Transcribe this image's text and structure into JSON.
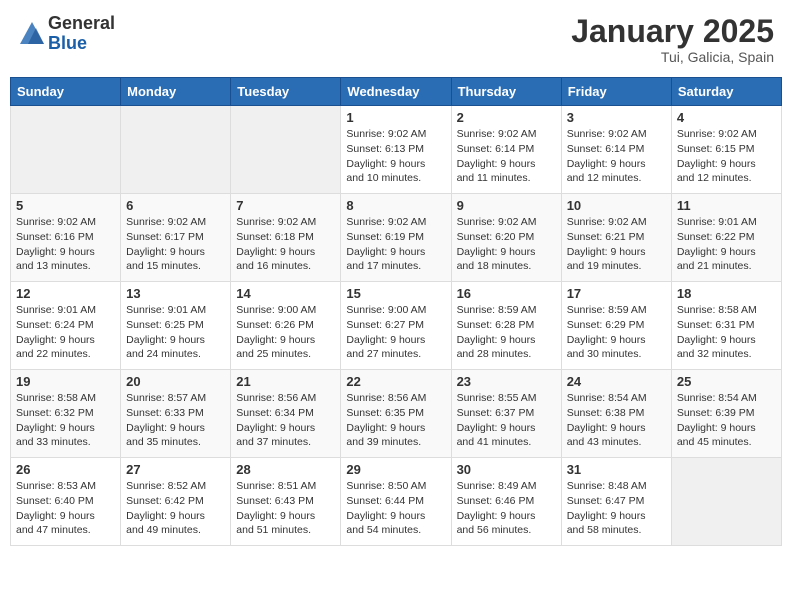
{
  "header": {
    "logo_general": "General",
    "logo_blue": "Blue",
    "month_title": "January 2025",
    "location": "Tui, Galicia, Spain"
  },
  "weekdays": [
    "Sunday",
    "Monday",
    "Tuesday",
    "Wednesday",
    "Thursday",
    "Friday",
    "Saturday"
  ],
  "weeks": [
    [
      {
        "day": "",
        "info": ""
      },
      {
        "day": "",
        "info": ""
      },
      {
        "day": "",
        "info": ""
      },
      {
        "day": "1",
        "info": "Sunrise: 9:02 AM\nSunset: 6:13 PM\nDaylight: 9 hours\nand 10 minutes."
      },
      {
        "day": "2",
        "info": "Sunrise: 9:02 AM\nSunset: 6:14 PM\nDaylight: 9 hours\nand 11 minutes."
      },
      {
        "day": "3",
        "info": "Sunrise: 9:02 AM\nSunset: 6:14 PM\nDaylight: 9 hours\nand 12 minutes."
      },
      {
        "day": "4",
        "info": "Sunrise: 9:02 AM\nSunset: 6:15 PM\nDaylight: 9 hours\nand 12 minutes."
      }
    ],
    [
      {
        "day": "5",
        "info": "Sunrise: 9:02 AM\nSunset: 6:16 PM\nDaylight: 9 hours\nand 13 minutes."
      },
      {
        "day": "6",
        "info": "Sunrise: 9:02 AM\nSunset: 6:17 PM\nDaylight: 9 hours\nand 15 minutes."
      },
      {
        "day": "7",
        "info": "Sunrise: 9:02 AM\nSunset: 6:18 PM\nDaylight: 9 hours\nand 16 minutes."
      },
      {
        "day": "8",
        "info": "Sunrise: 9:02 AM\nSunset: 6:19 PM\nDaylight: 9 hours\nand 17 minutes."
      },
      {
        "day": "9",
        "info": "Sunrise: 9:02 AM\nSunset: 6:20 PM\nDaylight: 9 hours\nand 18 minutes."
      },
      {
        "day": "10",
        "info": "Sunrise: 9:02 AM\nSunset: 6:21 PM\nDaylight: 9 hours\nand 19 minutes."
      },
      {
        "day": "11",
        "info": "Sunrise: 9:01 AM\nSunset: 6:22 PM\nDaylight: 9 hours\nand 21 minutes."
      }
    ],
    [
      {
        "day": "12",
        "info": "Sunrise: 9:01 AM\nSunset: 6:24 PM\nDaylight: 9 hours\nand 22 minutes."
      },
      {
        "day": "13",
        "info": "Sunrise: 9:01 AM\nSunset: 6:25 PM\nDaylight: 9 hours\nand 24 minutes."
      },
      {
        "day": "14",
        "info": "Sunrise: 9:00 AM\nSunset: 6:26 PM\nDaylight: 9 hours\nand 25 minutes."
      },
      {
        "day": "15",
        "info": "Sunrise: 9:00 AM\nSunset: 6:27 PM\nDaylight: 9 hours\nand 27 minutes."
      },
      {
        "day": "16",
        "info": "Sunrise: 8:59 AM\nSunset: 6:28 PM\nDaylight: 9 hours\nand 28 minutes."
      },
      {
        "day": "17",
        "info": "Sunrise: 8:59 AM\nSunset: 6:29 PM\nDaylight: 9 hours\nand 30 minutes."
      },
      {
        "day": "18",
        "info": "Sunrise: 8:58 AM\nSunset: 6:31 PM\nDaylight: 9 hours\nand 32 minutes."
      }
    ],
    [
      {
        "day": "19",
        "info": "Sunrise: 8:58 AM\nSunset: 6:32 PM\nDaylight: 9 hours\nand 33 minutes."
      },
      {
        "day": "20",
        "info": "Sunrise: 8:57 AM\nSunset: 6:33 PM\nDaylight: 9 hours\nand 35 minutes."
      },
      {
        "day": "21",
        "info": "Sunrise: 8:56 AM\nSunset: 6:34 PM\nDaylight: 9 hours\nand 37 minutes."
      },
      {
        "day": "22",
        "info": "Sunrise: 8:56 AM\nSunset: 6:35 PM\nDaylight: 9 hours\nand 39 minutes."
      },
      {
        "day": "23",
        "info": "Sunrise: 8:55 AM\nSunset: 6:37 PM\nDaylight: 9 hours\nand 41 minutes."
      },
      {
        "day": "24",
        "info": "Sunrise: 8:54 AM\nSunset: 6:38 PM\nDaylight: 9 hours\nand 43 minutes."
      },
      {
        "day": "25",
        "info": "Sunrise: 8:54 AM\nSunset: 6:39 PM\nDaylight: 9 hours\nand 45 minutes."
      }
    ],
    [
      {
        "day": "26",
        "info": "Sunrise: 8:53 AM\nSunset: 6:40 PM\nDaylight: 9 hours\nand 47 minutes."
      },
      {
        "day": "27",
        "info": "Sunrise: 8:52 AM\nSunset: 6:42 PM\nDaylight: 9 hours\nand 49 minutes."
      },
      {
        "day": "28",
        "info": "Sunrise: 8:51 AM\nSunset: 6:43 PM\nDaylight: 9 hours\nand 51 minutes."
      },
      {
        "day": "29",
        "info": "Sunrise: 8:50 AM\nSunset: 6:44 PM\nDaylight: 9 hours\nand 54 minutes."
      },
      {
        "day": "30",
        "info": "Sunrise: 8:49 AM\nSunset: 6:46 PM\nDaylight: 9 hours\nand 56 minutes."
      },
      {
        "day": "31",
        "info": "Sunrise: 8:48 AM\nSunset: 6:47 PM\nDaylight: 9 hours\nand 58 minutes."
      },
      {
        "day": "",
        "info": ""
      }
    ]
  ]
}
